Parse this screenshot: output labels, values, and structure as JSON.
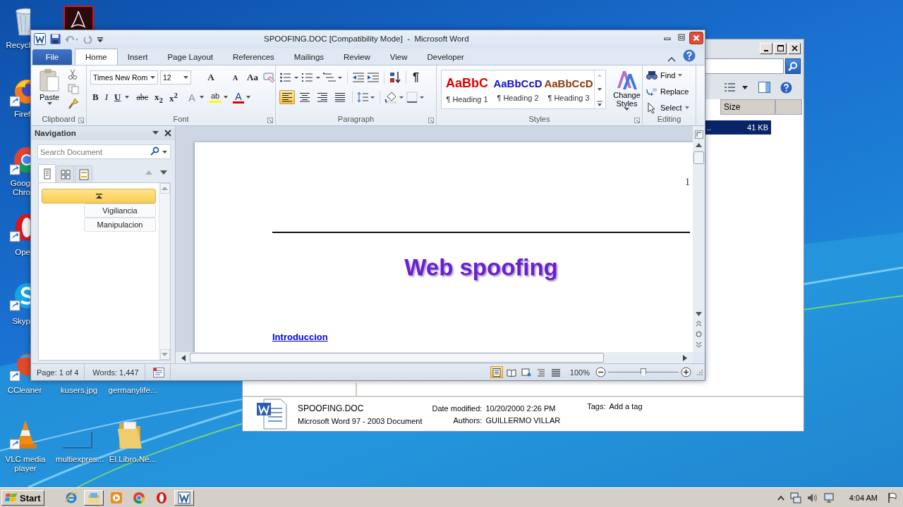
{
  "desktop_icons": [
    {
      "kind": "recycle",
      "label": "Recycl",
      "shortcut": false
    },
    {
      "kind": "pdf",
      "shortcut": false
    },
    {
      "kind": "firefox",
      "label": "Firef",
      "shortcut": true
    },
    {
      "kind": "chrome",
      "label": "Goog\nChro",
      "shortcut": true
    },
    {
      "kind": "opera",
      "label": "Ope",
      "shortcut": true
    },
    {
      "kind": "skype",
      "label": "Skyp",
      "shortcut": true
    },
    {
      "kind": "ccleaner",
      "label": "CCleaner",
      "shortcut": true
    },
    {
      "kind": "none",
      "label": "kusers.jpg"
    },
    {
      "kind": "none",
      "label": "germanylife.:."
    },
    {
      "kind": "vlc",
      "label": "VLC media\nplayer",
      "shortcut": true
    },
    {
      "kind": "image",
      "label": "multiexpres.:.",
      "shortcut": false
    },
    {
      "kind": "folder",
      "label": "El.Libro.Ne...",
      "shortcut": false
    }
  ],
  "explorer": {
    "column_header": "Size",
    "selected_row": {
      "name": "..",
      "size": "41 KB",
      "selected": true
    },
    "details": {
      "file_name": "SPOOFING.DOC",
      "file_type": "Microsoft Word 97 - 2003 Document",
      "date_label": "Date modified:",
      "date": "10/20/2000 2:26 PM",
      "authors_label": "Authors:",
      "authors": "GUILLERMO VILLAR",
      "tags_label": "Tags:",
      "tags": "Add a tag"
    }
  },
  "word": {
    "title": "SPOOFING.DOC [Compatibility Mode]  -  Microsoft Word",
    "tabs": [
      {
        "label": "File",
        "kind": "file",
        "selected": false
      },
      {
        "label": "Home",
        "kind": "tab",
        "selected": true
      },
      {
        "label": "Insert",
        "kind": "tab",
        "selected": false
      },
      {
        "label": "Page Layout",
        "kind": "tab",
        "selected": false
      },
      {
        "label": "References",
        "kind": "tab",
        "selected": false
      },
      {
        "label": "Mailings",
        "kind": "tab",
        "selected": false
      },
      {
        "label": "Review",
        "kind": "tab",
        "selected": false
      },
      {
        "label": "View",
        "kind": "tab",
        "selected": false
      },
      {
        "label": "Developer",
        "kind": "tab",
        "selected": false
      }
    ],
    "ribbon": {
      "paste": "Paste",
      "font_name": "Times New Rom",
      "font_size": "12",
      "font_buttons": [
        {
          "label": "A",
          "kind": "grow"
        },
        {
          "label": "A",
          "kind": "shrink"
        },
        {
          "label": "Aa",
          "kind": "case"
        }
      ],
      "format_buttons": [
        {
          "label": "B",
          "kind": "bold"
        },
        {
          "label": "I",
          "kind": "italic"
        },
        {
          "label": "U",
          "kind": "underline"
        },
        {
          "label": "abc",
          "kind": "strike"
        },
        {
          "label": "x$_{2}$",
          "kind": "subscript"
        },
        {
          "label": "x$^{2}$",
          "kind": "superscript"
        },
        {
          "label": "A",
          "kind": "effects"
        },
        {
          "label": "ab",
          "kind": "highlight"
        },
        {
          "label": "A",
          "kind": "color"
        }
      ],
      "show_marks": "¶",
      "align_buttons": [
        {
          "kind": "left",
          "selected": true
        },
        {
          "kind": "center",
          "selected": false
        },
        {
          "kind": "right",
          "selected": false
        },
        {
          "kind": "justify",
          "selected": false
        }
      ],
      "styles": [
        {
          "sample": "AaBbC",
          "name": "¶ Heading 1",
          "color": "#e00000"
        },
        {
          "sample": "AaBbCcD",
          "name": "¶ Heading 2",
          "color": "#1010c8"
        },
        {
          "sample": "AaBbCcD",
          "name": "¶ Heading 3",
          "color": "#8a3a0a"
        }
      ],
      "change_styles": "Change Styles",
      "find": "Find",
      "replace": "Replace",
      "select": "Select",
      "groups": [
        "Clipboard",
        "Font",
        "Paragraph",
        "Styles",
        "Editing"
      ]
    },
    "navigation": {
      "title": "Navigation",
      "search_placeholder": "Search Document",
      "view_tabs": [
        {
          "kind": "headings",
          "selected": true
        },
        {
          "kind": "pages",
          "selected": false
        },
        {
          "kind": "results",
          "selected": false
        }
      ],
      "headings": [
        {
          "kind": "collapsed",
          "selected": true
        },
        {
          "kind": "subheading",
          "label": "Vigiliancia",
          "selected": false
        },
        {
          "kind": "subheading",
          "label": "Manipulacion",
          "selected": false
        }
      ]
    },
    "document": {
      "page_number": "1",
      "title": "Web spoofing",
      "heading": "Introduccion"
    },
    "status_bar": {
      "page": "Page: 1 of 4",
      "words": "Words: 1,447",
      "zoom": "100%",
      "zoom_slider": {
        "level": 0.5
      },
      "view_buttons": [
        {
          "kind": "print",
          "selected": true
        },
        {
          "kind": "reading",
          "selected": false
        },
        {
          "kind": "web",
          "selected": false
        },
        {
          "kind": "outline",
          "selected": false
        },
        {
          "kind": "draft",
          "selected": false
        }
      ]
    }
  },
  "taskbar": {
    "start": "Start",
    "time": "4:04 AM",
    "apps": [
      {
        "kind": "ie",
        "selected": false
      },
      {
        "kind": "explorer",
        "selected": true
      },
      {
        "kind": "media",
        "selected": false
      },
      {
        "kind": "chrome",
        "selected": false
      },
      {
        "kind": "opera",
        "selected": false
      },
      {
        "kind": "word",
        "selected": true
      }
    ]
  }
}
